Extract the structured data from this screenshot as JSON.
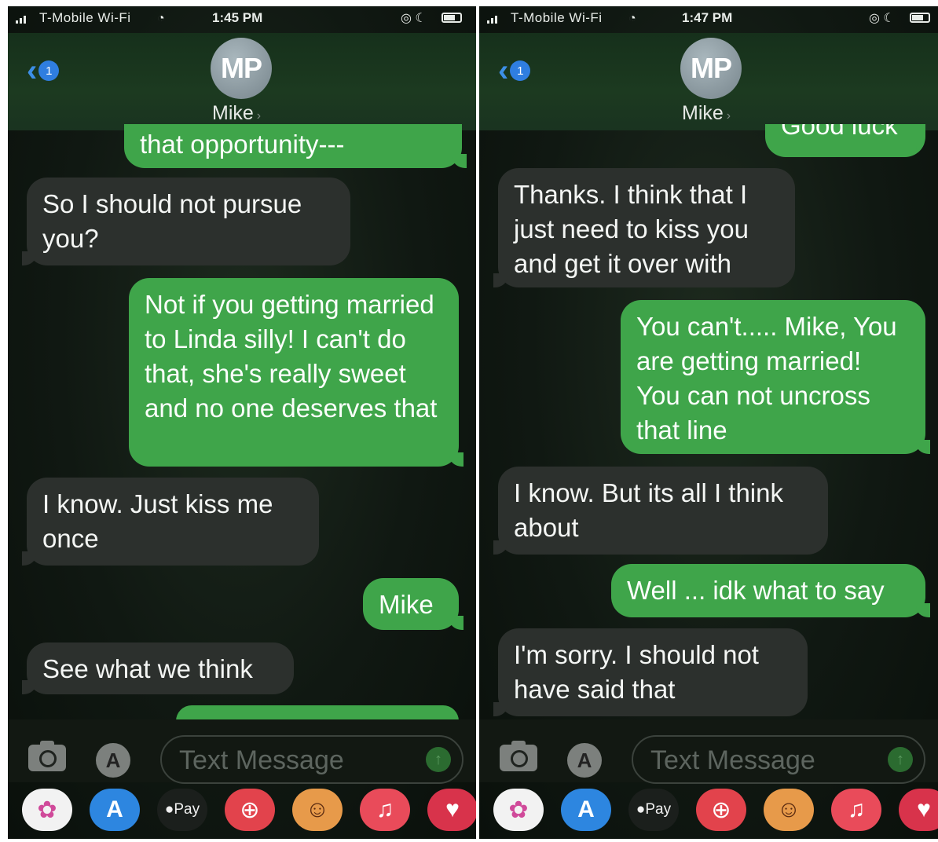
{
  "screens": [
    {
      "status": {
        "carrier": "T-Mobile Wi-Fi",
        "time": "1:45 PM"
      },
      "header": {
        "back_badge": "1",
        "avatar_initials": "MP",
        "contact_name": "Mike"
      },
      "messages": [
        {
          "dir": "out",
          "text": "that opportunity---"
        },
        {
          "dir": "in",
          "text": "So I should not pursue you?"
        },
        {
          "dir": "out",
          "text": "Not if you getting married to Linda silly! I can't do that, she's really sweet and no one deserves that"
        },
        {
          "dir": "in",
          "text": "I know. Just kiss me once"
        },
        {
          "dir": "out",
          "text": "Mike"
        },
        {
          "dir": "in",
          "text": "See what we think"
        }
      ],
      "input": {
        "placeholder": "Text Message"
      },
      "tray": {
        "pay_label": "Pay"
      }
    },
    {
      "status": {
        "carrier": "T-Mobile Wi-Fi",
        "time": "1:47 PM"
      },
      "header": {
        "back_badge": "1",
        "avatar_initials": "MP",
        "contact_name": "Mike"
      },
      "messages": [
        {
          "dir": "out",
          "text": "Good luck"
        },
        {
          "dir": "in",
          "text": "Thanks. I think that I just need to kiss you and get it over with"
        },
        {
          "dir": "out",
          "text": "You can't..... Mike, You are getting married! You can not uncross that line"
        },
        {
          "dir": "in",
          "text": "I know. But its all I think about"
        },
        {
          "dir": "out",
          "text": "Well ... idk what to say"
        },
        {
          "dir": "in",
          "text": "I'm sorry. I should not have said that"
        }
      ],
      "input": {
        "placeholder": "Text Message"
      },
      "tray": {
        "pay_label": "Pay"
      }
    }
  ],
  "icons": {
    "back": "chevron-left-icon",
    "camera": "camera-icon",
    "appstore": "app-store-icon",
    "send": "send-arrow-icon",
    "battery": "battery-icon",
    "wifi": "wifi-icon",
    "signal": "signal-icon"
  },
  "colors": {
    "outgoing_bubble": "#3fa54a",
    "incoming_bubble": "#2c302d",
    "badge": "#2f7ee0",
    "background": "#101812"
  }
}
